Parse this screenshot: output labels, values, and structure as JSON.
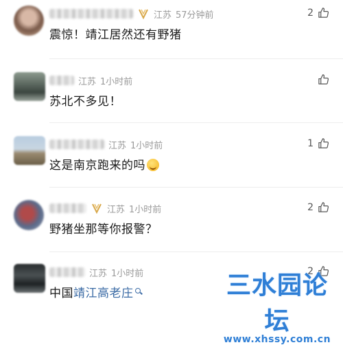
{
  "comments": [
    {
      "location": "江苏",
      "time": "57分钟前",
      "text": "震惊！靖江居然还有野猪",
      "likes": "2",
      "vip": true
    },
    {
      "location": "江苏",
      "time": "1小时前",
      "text": "苏北不多见！",
      "likes": "",
      "vip": false
    },
    {
      "location": "江苏",
      "time": "1小时前",
      "text": "这是南京跑来的吗",
      "likes": "1",
      "vip": false
    },
    {
      "location": "江苏",
      "time": "1小时前",
      "text": "野猪坐那等你报警？",
      "likes": "2",
      "vip": true
    },
    {
      "location": "江苏",
      "time": "1小时前",
      "text_prefix": "中国",
      "text_link": "靖江高老庄",
      "likes": "2",
      "vip": false
    }
  ],
  "watermark": {
    "title": "三水园论坛",
    "url": "www.xhssy.com.cn"
  },
  "colors": {
    "link": "#3b6ba5",
    "watermark": "#2f7fd6",
    "meta": "#9a9a9a"
  },
  "icons": {
    "like": "thumbs-up-icon",
    "vip": "vip-badge-icon",
    "search": "search-icon",
    "emoji": "laughing-emoji-icon"
  }
}
